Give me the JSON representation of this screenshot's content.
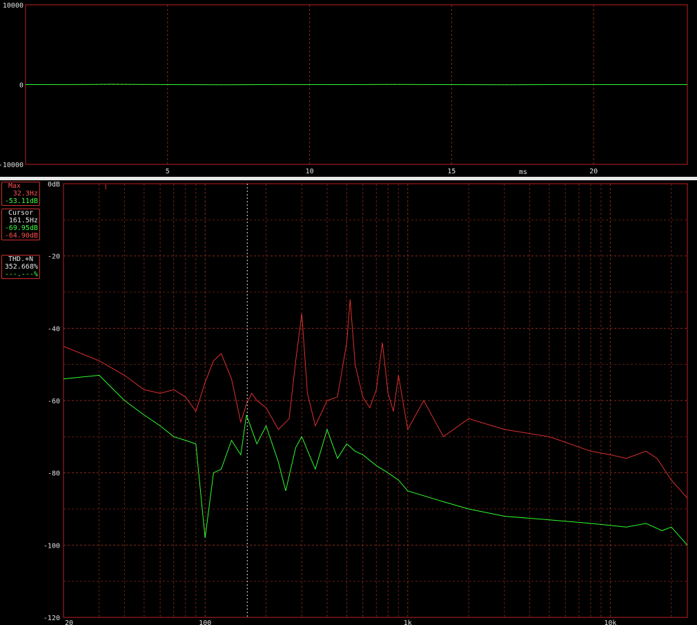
{
  "scope": {
    "y_ticks": [
      "10000",
      "0",
      "-10000"
    ],
    "x_ticks": [
      "5",
      "10",
      "15",
      "20"
    ],
    "x_unit": "ms"
  },
  "spectrum": {
    "y_ticks": [
      "0dB",
      "-20",
      "-40",
      "-60",
      "-80",
      "-100",
      "-120"
    ],
    "x_ticks": [
      "20",
      "100",
      "1k",
      "10k"
    ]
  },
  "panels": {
    "max": {
      "title": "Max",
      "freq": "32.3Hz",
      "level": "-53.11dB"
    },
    "cursor": {
      "title": "Cursor",
      "freq": "161.5Hz",
      "level_green": "-69.95dB",
      "level_red": "-64.90dB"
    },
    "thd": {
      "title": "THD.+N",
      "value_red": "352.668%",
      "value_green": "---.---%"
    }
  },
  "colors": {
    "series_red": "#e03030",
    "series_green": "#30ff30",
    "grid": "#8a2a1a",
    "frame": "#c02020"
  },
  "chart_data": [
    {
      "type": "line",
      "title": "",
      "xlabel": "ms",
      "ylabel": "",
      "xlim": [
        0,
        23.3
      ],
      "ylim": [
        -10000,
        10000
      ],
      "series": [
        {
          "color": "#30ff30",
          "x": [
            0,
            2,
            3,
            5,
            7,
            9,
            11,
            13,
            15,
            17,
            19,
            21,
            23.3
          ],
          "y": [
            0,
            10,
            40,
            0,
            -20,
            10,
            0,
            20,
            0,
            -20,
            10,
            0,
            0
          ]
        }
      ]
    },
    {
      "type": "line",
      "title": "",
      "xscale": "log",
      "xlim": [
        20,
        24000
      ],
      "ylim": [
        -120,
        0
      ],
      "grid": true,
      "series": [
        {
          "color": "#e03030",
          "x": [
            20,
            30,
            40,
            50,
            60,
            70,
            80,
            90,
            100,
            110,
            120,
            135,
            150,
            160,
            170,
            180,
            200,
            230,
            260,
            280,
            300,
            320,
            350,
            400,
            450,
            500,
            520,
            550,
            600,
            650,
            700,
            750,
            800,
            850,
            900,
            1000,
            1200,
            1500,
            2000,
            3000,
            5000,
            8000,
            10000,
            12000,
            15000,
            17000,
            20000,
            24000
          ],
          "y": [
            -45,
            -49,
            -53,
            -57,
            -58,
            -57,
            -59,
            -63,
            -55,
            -49,
            -47,
            -54,
            -66,
            -61,
            -58,
            -60,
            -62,
            -68,
            -65,
            -49,
            -36,
            -58,
            -67,
            -60,
            -59,
            -44,
            -32,
            -50,
            -59,
            -62,
            -57,
            -44,
            -58,
            -63,
            -53,
            -68,
            -60,
            -70,
            -65,
            -68,
            -70,
            -74,
            -75,
            -76,
            -74,
            -76,
            -82,
            -87
          ]
        },
        {
          "color": "#30ff30",
          "x": [
            20,
            30,
            40,
            50,
            60,
            70,
            80,
            90,
            100,
            110,
            120,
            135,
            150,
            160,
            180,
            200,
            230,
            250,
            280,
            300,
            350,
            400,
            450,
            500,
            550,
            600,
            700,
            800,
            900,
            1000,
            1500,
            2000,
            3000,
            5000,
            8000,
            12000,
            15000,
            18000,
            20000,
            24000
          ],
          "y": [
            -54,
            -53,
            -60,
            -64,
            -67,
            -70,
            -71,
            -72,
            -98,
            -80,
            -79,
            -71,
            -75,
            -64,
            -72,
            -67,
            -77,
            -85,
            -73,
            -70,
            -79,
            -68,
            -76,
            -72,
            -74,
            -75,
            -78,
            -80,
            -82,
            -85,
            -88,
            -90,
            -92,
            -93,
            -94,
            -95,
            -94,
            -96,
            -95,
            -100
          ]
        }
      ]
    }
  ]
}
